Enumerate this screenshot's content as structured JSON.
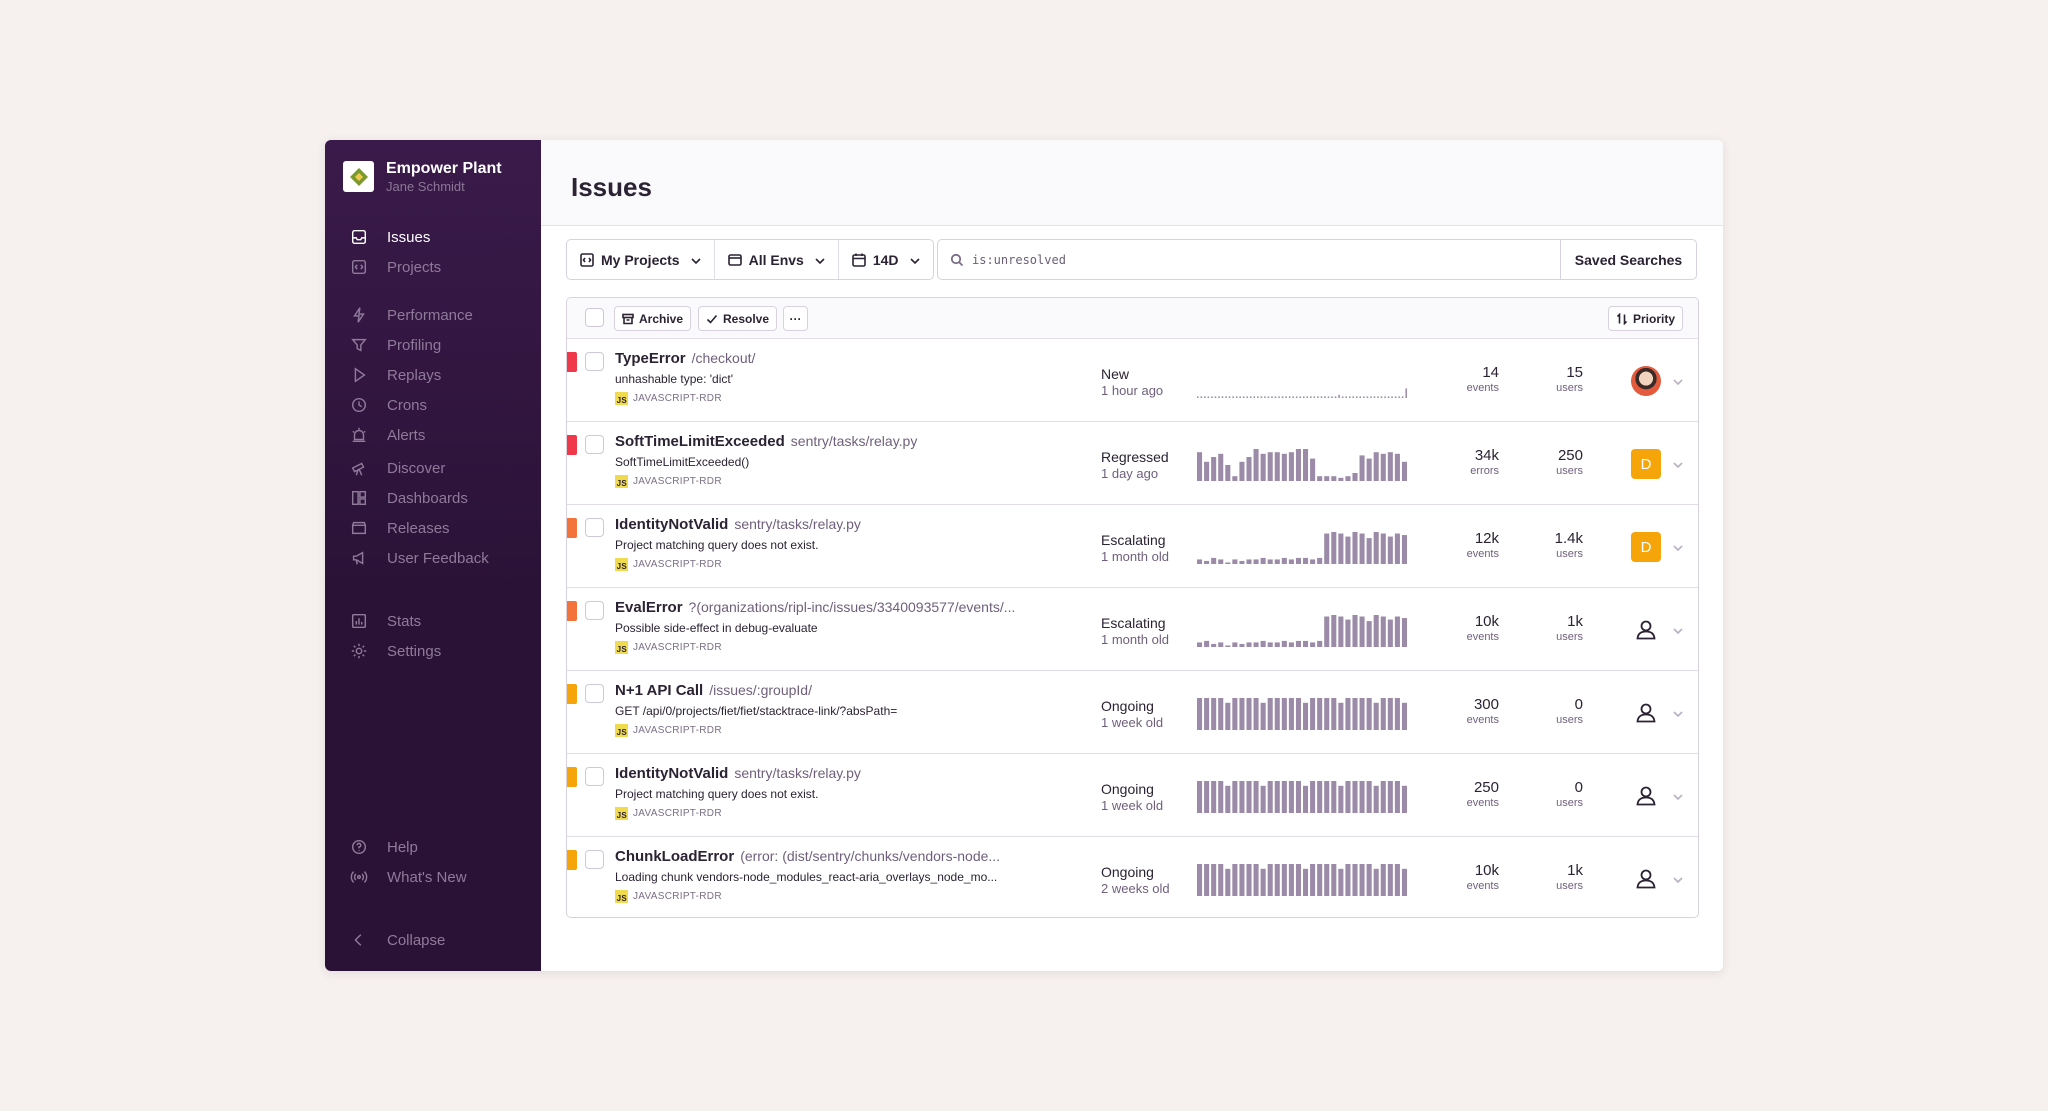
{
  "org": {
    "name": "Empower Plant",
    "user": "Jane Schmidt"
  },
  "nav": {
    "group1": [
      {
        "label": "Issues",
        "icon": "inbox-icon",
        "active": true
      },
      {
        "label": "Projects",
        "icon": "code-icon"
      }
    ],
    "group2": [
      {
        "label": "Performance",
        "icon": "lightning-icon"
      },
      {
        "label": "Profiling",
        "icon": "funnel-icon"
      },
      {
        "label": "Replays",
        "icon": "play-icon"
      },
      {
        "label": "Crons",
        "icon": "history-icon"
      },
      {
        "label": "Alerts",
        "icon": "siren-icon"
      }
    ],
    "group3": [
      {
        "label": "Discover",
        "icon": "telescope-icon"
      },
      {
        "label": "Dashboards",
        "icon": "dashboard-icon"
      },
      {
        "label": "Releases",
        "icon": "package-icon"
      },
      {
        "label": "User Feedback",
        "icon": "megaphone-icon"
      }
    ],
    "group4": [
      {
        "label": "Stats",
        "icon": "stats-icon"
      },
      {
        "label": "Settings",
        "icon": "gear-icon"
      }
    ],
    "footer": [
      {
        "label": "Help",
        "icon": "question-icon"
      },
      {
        "label": "What's New",
        "icon": "broadcast-icon"
      }
    ],
    "collapse": "Collapse"
  },
  "page": {
    "title": "Issues"
  },
  "filters": {
    "projects": "My Projects",
    "envs": "All Envs",
    "period": "14D"
  },
  "search": {
    "query": "is:unresolved",
    "saved_label": "Saved Searches"
  },
  "toolbar": {
    "archive": "Archive",
    "resolve": "Resolve",
    "more": "···",
    "sort": "Priority"
  },
  "colors": {
    "sidebar": "#2a1236",
    "high": "#f0384b",
    "medium": "#f4733a",
    "low": "#f5a50a",
    "spark": "#9b8ba8",
    "avatar_bg": "#f5a50a"
  },
  "issues": [
    {
      "title": "TypeError",
      "path": "/checkout/",
      "message": "unhashable type: 'dict'",
      "project": "JAVASCRIPT-RDR",
      "status": "New",
      "age": "1 hour ago",
      "count": "14",
      "count_unit": "events",
      "users": "15",
      "users_unit": "users",
      "assignee": "photo",
      "priority": "high",
      "spark": [
        1,
        1,
        1,
        1,
        1,
        1,
        1,
        1,
        1,
        1,
        1,
        1,
        1,
        1,
        1,
        1,
        1,
        1,
        1,
        1,
        1,
        1,
        1,
        1,
        1,
        1,
        1,
        1,
        1,
        1,
        1,
        1,
        1,
        1,
        1,
        1,
        1,
        1,
        1,
        1,
        2,
        1,
        1,
        1,
        1,
        1,
        1,
        1,
        1,
        1,
        1,
        1,
        1,
        1,
        1,
        1,
        1,
        1,
        1,
        6
      ]
    },
    {
      "title": "SoftTimeLimitExceeded",
      "path": "sentry/tasks/relay.py",
      "message": "SoftTimeLimitExceeded()",
      "project": "JAVASCRIPT-RDR",
      "status": "Regressed",
      "age": "1 day ago",
      "count": "34k",
      "count_unit": "errors",
      "users": "250",
      "users_unit": "users",
      "assignee": "D",
      "priority": "high",
      "spark": [
        18,
        12,
        15,
        17,
        10,
        3,
        12,
        15,
        20,
        17,
        18,
        18,
        17,
        18,
        20,
        20,
        14,
        3,
        3,
        3,
        2,
        3,
        5,
        16,
        14,
        18,
        17,
        18,
        17,
        12
      ]
    },
    {
      "title": "IdentityNotValid",
      "path": "sentry/tasks/relay.py",
      "message": "Project matching query does not exist.",
      "project": "JAVASCRIPT-RDR",
      "status": "Escalating",
      "age": "1 month old",
      "count": "12k",
      "count_unit": "events",
      "users": "1.4k",
      "users_unit": "users",
      "assignee": "D",
      "priority": "medium",
      "spark": [
        3,
        2,
        4,
        3,
        1,
        3,
        2,
        3,
        3,
        4,
        3,
        3,
        4,
        3,
        4,
        4,
        3,
        4,
        20,
        21,
        20,
        18,
        21,
        20,
        17,
        21,
        20,
        18,
        20,
        19
      ]
    },
    {
      "title": "EvalError",
      "path": "?(organizations/ripl-inc/issues/3340093577/events/...",
      "message": "Possible side-effect in debug-evaluate",
      "project": "JAVASCRIPT-RDR",
      "status": "Escalating",
      "age": "1 month old",
      "count": "10k",
      "count_unit": "events",
      "users": "1k",
      "users_unit": "users",
      "assignee": "user",
      "priority": "medium",
      "spark": [
        3,
        4,
        2,
        3,
        1,
        3,
        2,
        3,
        3,
        4,
        3,
        3,
        4,
        3,
        4,
        4,
        3,
        4,
        20,
        21,
        20,
        18,
        21,
        20,
        17,
        21,
        20,
        18,
        20,
        19
      ]
    },
    {
      "title": "N+1 API Call",
      "path": "/issues/:groupId/",
      "message": "GET /api/0/projects/fiet/fiet/stacktrace-link/?absPath=",
      "project": "JAVASCRIPT-RDR",
      "status": "Ongoing",
      "age": "1 week old",
      "count": "300",
      "count_unit": "events",
      "users": "0",
      "users_unit": "users",
      "assignee": "user",
      "priority": "low",
      "spark": [
        20,
        20,
        20,
        20,
        17,
        20,
        20,
        20,
        20,
        17,
        20,
        20,
        20,
        20,
        20,
        17,
        20,
        20,
        20,
        20,
        17,
        20,
        20,
        20,
        20,
        17,
        20,
        20,
        20,
        17
      ]
    },
    {
      "title": "IdentityNotValid",
      "path": "sentry/tasks/relay.py",
      "message": "Project matching query does not exist.",
      "project": "JAVASCRIPT-RDR",
      "status": "Ongoing",
      "age": "1 week old",
      "count": "250",
      "count_unit": "events",
      "users": "0",
      "users_unit": "users",
      "assignee": "user",
      "priority": "low",
      "spark": [
        20,
        20,
        20,
        20,
        17,
        20,
        20,
        20,
        20,
        17,
        20,
        20,
        20,
        20,
        20,
        17,
        20,
        20,
        20,
        20,
        17,
        20,
        20,
        20,
        20,
        17,
        20,
        20,
        20,
        17
      ]
    },
    {
      "title": "ChunkLoadError",
      "path": "(error: (dist/sentry/chunks/vendors-node...",
      "message": "Loading chunk vendors-node_modules_react-aria_overlays_node_mo...",
      "project": "JAVASCRIPT-RDR",
      "status": "Ongoing",
      "age": "2 weeks old",
      "count": "10k",
      "count_unit": "events",
      "users": "1k",
      "users_unit": "users",
      "assignee": "user",
      "priority": "low",
      "spark": [
        20,
        20,
        20,
        20,
        17,
        20,
        20,
        20,
        20,
        17,
        20,
        20,
        20,
        20,
        20,
        17,
        20,
        20,
        20,
        20,
        17,
        20,
        20,
        20,
        20,
        17,
        20,
        20,
        20,
        17
      ]
    }
  ]
}
